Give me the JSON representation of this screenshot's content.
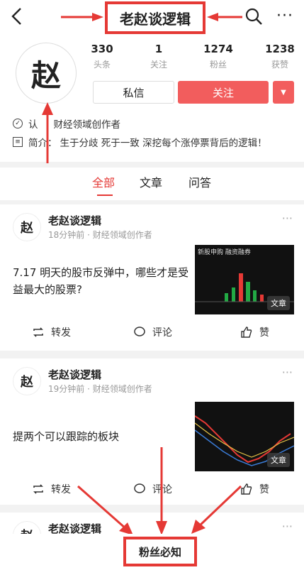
{
  "header": {
    "title": "老赵谈逻辑"
  },
  "profile": {
    "avatar_glyph": "赵",
    "stats": [
      {
        "num": "330",
        "label": "头条"
      },
      {
        "num": "1",
        "label": "关注"
      },
      {
        "num": "1274",
        "label": "粉丝"
      },
      {
        "num": "1238",
        "label": "获赞"
      }
    ],
    "message_label": "私信",
    "follow_label": "关注",
    "cert_prefix": "认",
    "cert_text": "财经领域创作者",
    "intro_prefix": "简介",
    "intro_text": "生于分歧 死于一致 深挖每个涨停票背后的逻辑！"
  },
  "tabs": [
    "全部",
    "文章",
    "问答"
  ],
  "posts": [
    {
      "name": "老赵谈逻辑",
      "meta": "18分钟前 · 财经领域创作者",
      "title": "7.17 明天的股市反弹中，哪些才是受益最大的股票?",
      "thumb_badge": "文章",
      "thumb_caption": "新股申购 融资融券",
      "repost": "转发",
      "comment": "评论",
      "like": "赞"
    },
    {
      "name": "老赵谈逻辑",
      "meta": "19分钟前 · 财经领域创作者",
      "title": "提两个可以跟踪的板块",
      "thumb_badge": "文章",
      "repost": "转发",
      "comment": "评论",
      "like": "赞"
    },
    {
      "name": "老赵谈逻辑"
    }
  ],
  "bottom_label": "粉丝必知",
  "colors": {
    "accent": "#e53935",
    "follow": "#f25d5d"
  }
}
